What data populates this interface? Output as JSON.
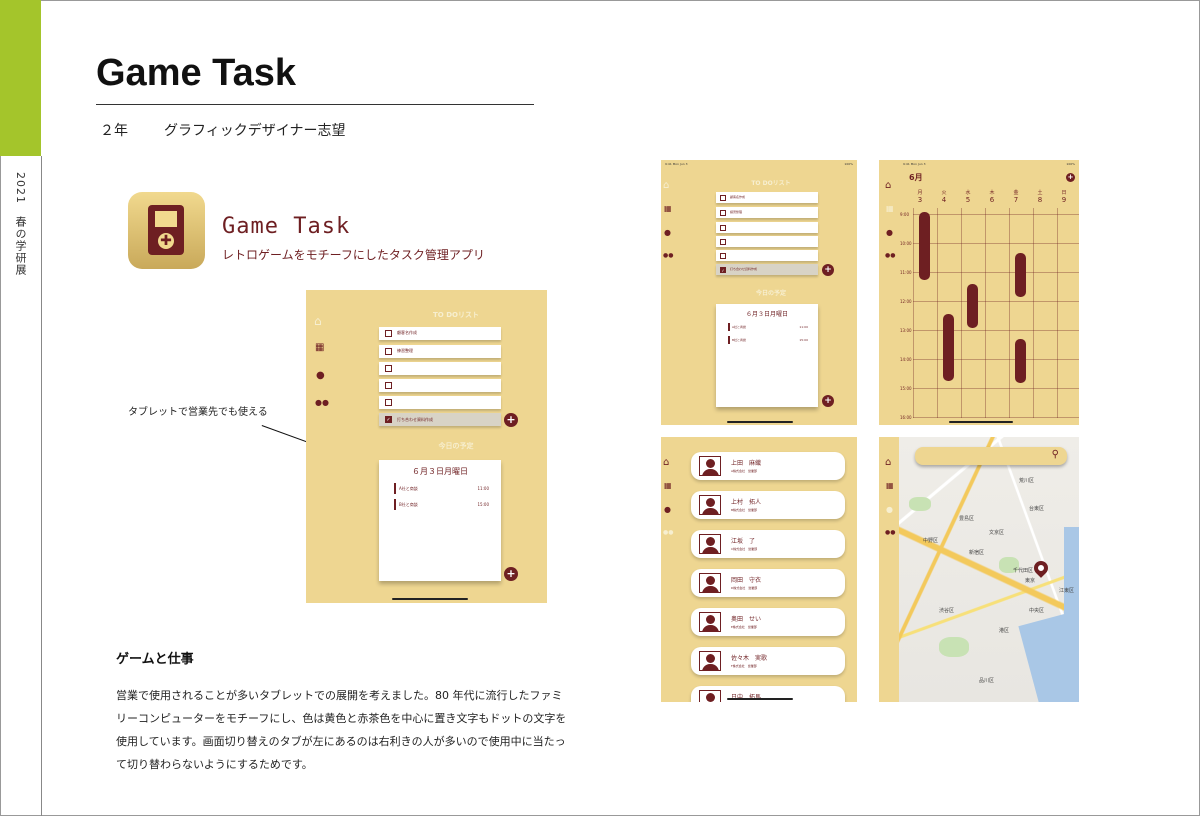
{
  "sidebar": {
    "label": "2021　春の学研展",
    "accent_color": "#a4c52b"
  },
  "header": {
    "title": "Game Task",
    "grade": "２年",
    "aspiration": "グラフィックデザイナー志望"
  },
  "app": {
    "name": "Game Task",
    "tagline": "レトロゲームをモチーフにしたタスク管理アプリ",
    "brand_color": "#6e1f22",
    "bg_color": "#eed691"
  },
  "annotation": "タブレットで営業先でも使える",
  "tablet": {
    "status_left": "9:41  Mon Jun 3",
    "status_right": "100%",
    "todo_title": "TO DOリスト",
    "todos": [
      {
        "text": "顧客名作成",
        "done": false
      },
      {
        "text": "練習整理",
        "done": false
      },
      {
        "text": "",
        "done": false
      },
      {
        "text": "",
        "done": false
      },
      {
        "text": "",
        "done": false
      },
      {
        "text": "打ち合わせ資料作成",
        "done": true
      }
    ],
    "schedule_title": "今日の予定",
    "schedule_date": "６月３日月曜日",
    "schedule_items": [
      {
        "text": "A社と商談",
        "time": "11:00"
      },
      {
        "text": "B社と商談",
        "time": "15:00"
      }
    ],
    "nav_icons": [
      "home-icon",
      "calendar-icon",
      "location-icon",
      "people-icon"
    ]
  },
  "calendar": {
    "month": "6月",
    "days": [
      {
        "wd": "月",
        "d": "3"
      },
      {
        "wd": "火",
        "d": "4"
      },
      {
        "wd": "水",
        "d": "5"
      },
      {
        "wd": "木",
        "d": "6"
      },
      {
        "wd": "金",
        "d": "7"
      },
      {
        "wd": "土",
        "d": "8"
      },
      {
        "wd": "日",
        "d": "9"
      }
    ],
    "hours": [
      "9:00",
      "10:00",
      "11:00",
      "12:00",
      "13:00",
      "14:00",
      "15:00",
      "16:00",
      "17:00"
    ]
  },
  "contacts": [
    {
      "name": "上田　麻織",
      "sub": "A株式会社　営業部"
    },
    {
      "name": "上村　拓人",
      "sub": "B株式会社　営業部"
    },
    {
      "name": "江坂　了",
      "sub": "C株式会社　営業部"
    },
    {
      "name": "岡田　守衣",
      "sub": "D株式会社　営業部"
    },
    {
      "name": "奥田　せい",
      "sub": "E株式会社　営業部"
    },
    {
      "name": "佐々木　実歌",
      "sub": "F株式会社　営業部"
    },
    {
      "name": "日中　拓馬",
      "sub": "G株式会社　営業部"
    }
  ],
  "map": {
    "labels": [
      "中野区",
      "新宿区",
      "千代田区",
      "東京",
      "文京区",
      "台東区",
      "港区",
      "渋谷区",
      "品川区",
      "豊島区",
      "荒川区",
      "中央区",
      "江東区"
    ]
  },
  "body": {
    "heading": "ゲームと仕事",
    "lines": [
      "営業で使用されることが多いタブレットでの展開を考えました。80 年代に流行したファミ",
      "リーコンピューターをモチーフにし、色は黄色と赤茶色を中心に置き文字もドットの文字を",
      "使用しています。画面切り替えのタブが左にあるのは右利きの人が多いので使用中に当たっ",
      "て切り替わらないようにするためです。"
    ]
  }
}
